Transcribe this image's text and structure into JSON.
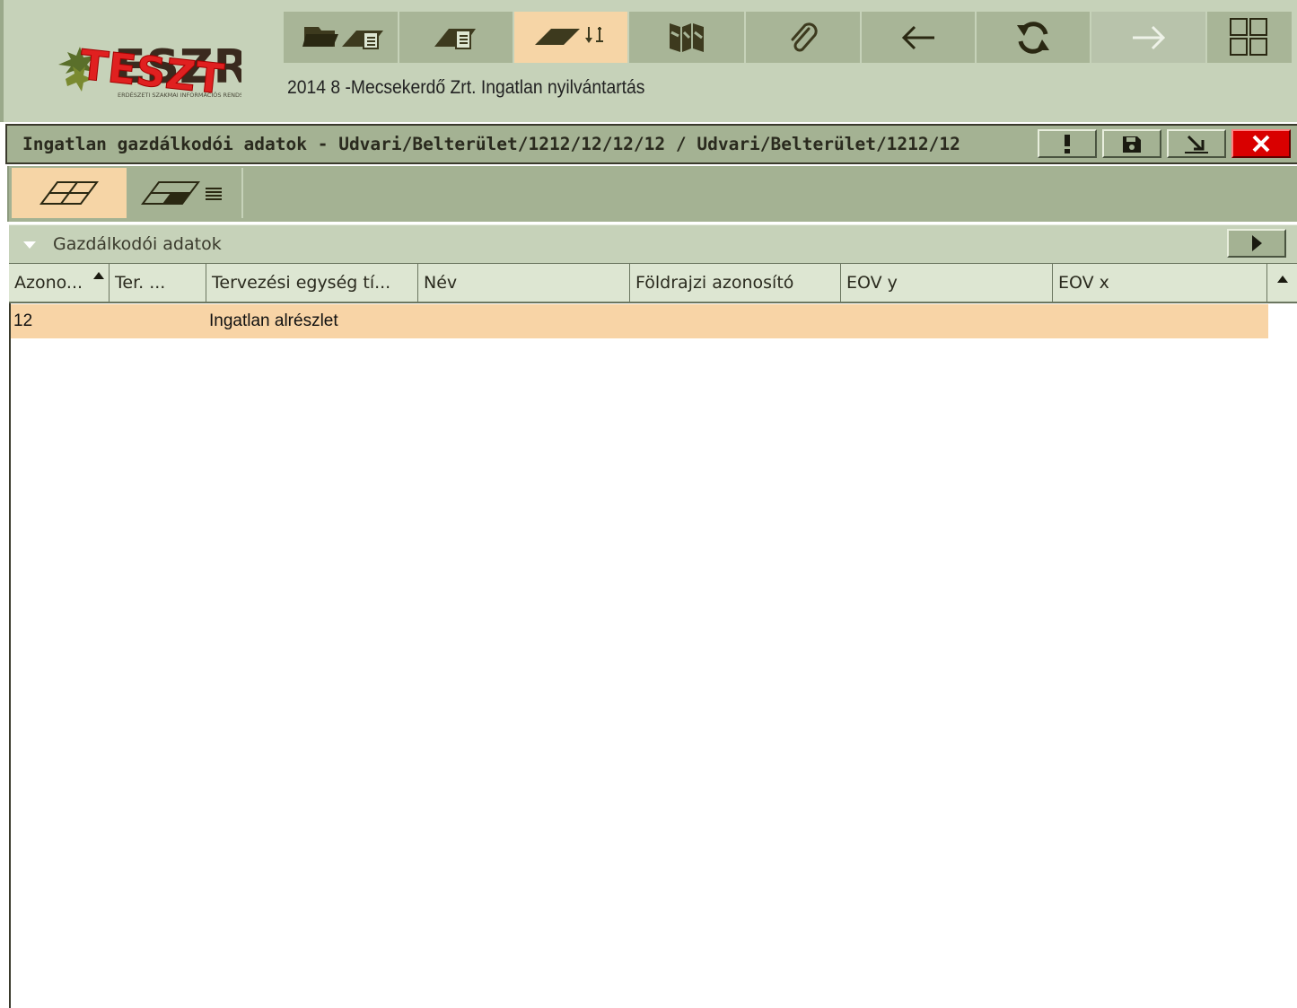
{
  "header": {
    "logo_text": "TESZT",
    "logo_back_text": "ESZR",
    "logo_subtext": "ERDÉSZETI SZAKMAI INFORMÁCIÓS RENDSZER",
    "subtitle": "2014 8 -Mecsekerdő Zrt. Ingatlan nyilvántartás",
    "toolbar": [
      {
        "icon": "open-folder-document-icon",
        "state": "normal"
      },
      {
        "icon": "parcel-document-icon",
        "state": "normal"
      },
      {
        "icon": "parcel-sort-icon",
        "state": "active"
      },
      {
        "icon": "map-icon",
        "state": "normal"
      },
      {
        "icon": "paperclip-icon",
        "state": "normal"
      },
      {
        "icon": "arrow-left-icon",
        "state": "normal"
      },
      {
        "icon": "refresh-icon",
        "state": "normal"
      },
      {
        "icon": "arrow-right-icon",
        "state": "disabled"
      },
      {
        "icon": "grid-layout-icon",
        "state": "normal"
      }
    ]
  },
  "window": {
    "title": "Ingatlan gazdálkodói adatok - Udvari/Belterület/1212/12/12/12 / Udvari/Belterület/1212/12",
    "buttons": [
      "exclamation-icon",
      "save-icon",
      "minimize-icon",
      "close-icon"
    ]
  },
  "subtoolbar": [
    {
      "icon": "parcel-grid-icon",
      "state": "active"
    },
    {
      "icon": "parcel-list-icon",
      "state": "normal"
    }
  ],
  "section": {
    "label": "Gazdálkodói adatok"
  },
  "grid": {
    "columns": [
      "Azono...",
      "Ter. ...",
      "Tervezési egység tí...",
      "Név",
      "Földrajzi azonosító",
      "EOV y",
      "EOV x"
    ],
    "sorted_column": "Azono...",
    "rows": [
      {
        "azonosito": "12",
        "ter": "",
        "tervezesi_egyseg": "Ingatlan alrészlet",
        "nev": "",
        "foldrajzi": "",
        "eov_y": "",
        "eov_x": ""
      }
    ]
  },
  "colors": {
    "header_bg": "#c6d2b9",
    "toolbar_btn": "#a8b597",
    "active": "#f6d5a6",
    "title_bar": "#a4b293",
    "close_red": "#d90000",
    "selected_row": "#f8d4a6",
    "logo_red": "#e02020"
  }
}
